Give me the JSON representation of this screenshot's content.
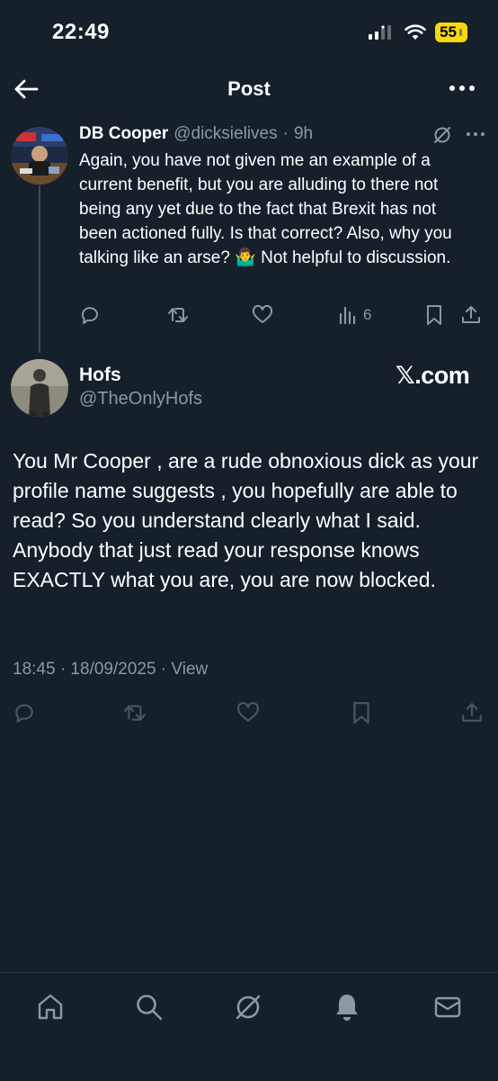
{
  "status_bar": {
    "time": "22:49",
    "battery": "55"
  },
  "header": {
    "title": "Post",
    "back_icon": "arrow-left-icon",
    "more_icon": "more-horizontal-icon"
  },
  "reply_tweet": {
    "name": "DB Cooper",
    "handle": "@dicksielives",
    "separator": "·",
    "age": "9h",
    "text": "Again, you have not given me an example of a current benefit, but you are alluding to there not being any yet due to the fact that Brexit has not been actioned fully. Is that correct? Also, why you talking like an arse? 🤷‍♂️ Not helpful to discussion.",
    "views": "6"
  },
  "main_post": {
    "name": "Hofs",
    "handle": "@TheOnlyHofs",
    "watermark": "𝕏.com",
    "text": "You Mr Cooper , are a rude obnoxious dick as your profile name suggests , you hopefully are able to read? So you understand clearly what I said. Anybody that just read your response knows EXACTLY what you are, you are now blocked.",
    "timestamp": "18:45 · 18/09/2025 · View"
  },
  "bottom_nav": {
    "items": [
      "home-icon",
      "search-icon",
      "grok-icon",
      "notifications-icon",
      "messages-icon"
    ]
  },
  "colors": {
    "background": "#15202b",
    "muted": "#8b98a5",
    "battery": "#f5d90a"
  }
}
